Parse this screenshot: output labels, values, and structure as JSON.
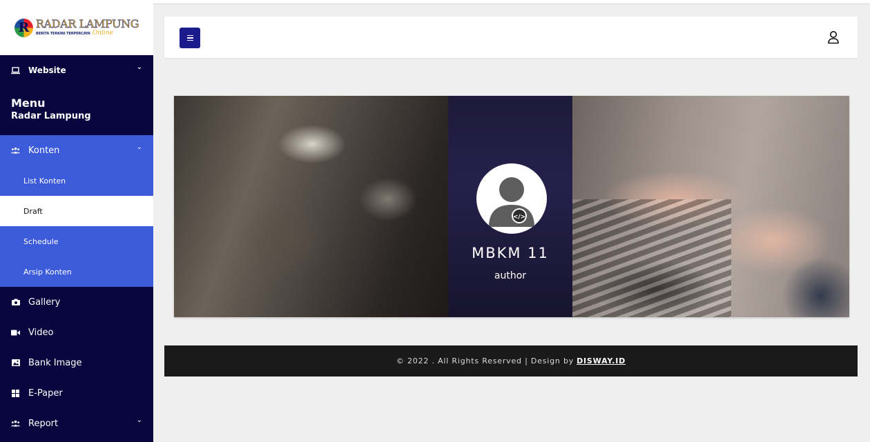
{
  "brand": {
    "logo_letter": "R",
    "name": "RADAR LAMPUNG",
    "tagline": "BERITA TERKINI TERPERCAYA",
    "online": "Online"
  },
  "sidebar": {
    "website_label": "Website",
    "menu_title": "Menu",
    "menu_subtitle": "Radar Lampung",
    "konten_label": "Konten",
    "konten_subitems": [
      {
        "label": "List Konten"
      },
      {
        "label": "Draft"
      },
      {
        "label": "Schedule"
      },
      {
        "label": "Arsip Konten"
      }
    ],
    "items": [
      {
        "label": "Gallery",
        "icon": "camera-icon"
      },
      {
        "label": "Video",
        "icon": "video-icon"
      },
      {
        "label": "Bank Image",
        "icon": "image-icon"
      },
      {
        "label": "E-Paper",
        "icon": "grid-icon"
      },
      {
        "label": "Report",
        "icon": "users-icon"
      }
    ],
    "active_subitem": "Draft"
  },
  "profile": {
    "name": "MBKM 11",
    "role": "author"
  },
  "footer": {
    "text": "© 2022 . All Rights Reserved | Design by",
    "link": "DISWAY.ID"
  },
  "colors": {
    "sidebar_bg": "#08053e",
    "accent": "#3b5bdb",
    "menu_button": "#1a1a8c",
    "footer_bg": "#1a1a1a"
  }
}
